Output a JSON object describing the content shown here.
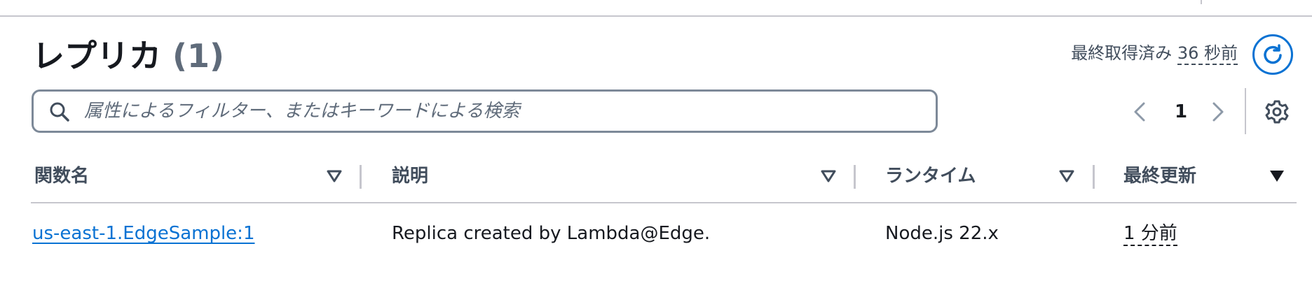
{
  "replicas": {
    "title": "レプリカ",
    "count": "(1)",
    "last_fetched_prefix": "最終取得済み",
    "last_fetched_age": "36 秒前",
    "search_placeholder": "属性によるフィルター、またはキーワードによる検索",
    "page_number": "1",
    "columns": [
      "関数名",
      "説明",
      "ランタイム",
      "最終更新"
    ],
    "rows": [
      {
        "function_name": "us-east-1.EdgeSample:1",
        "description": "Replica created by Lambda@Edge.",
        "runtime": "Node.js 22.x",
        "last_modified": "1 分前"
      }
    ],
    "active_sort_column": "最終更新"
  },
  "colors": {
    "accent": "#0972d3",
    "text": "#16191f",
    "muted": "#5f6b7a",
    "border": "#7d8998"
  },
  "icons": [
    "refresh-icon",
    "search-icon",
    "chevron-left-icon",
    "chevron-right-icon",
    "gear-icon",
    "sort-caret-icon"
  ]
}
